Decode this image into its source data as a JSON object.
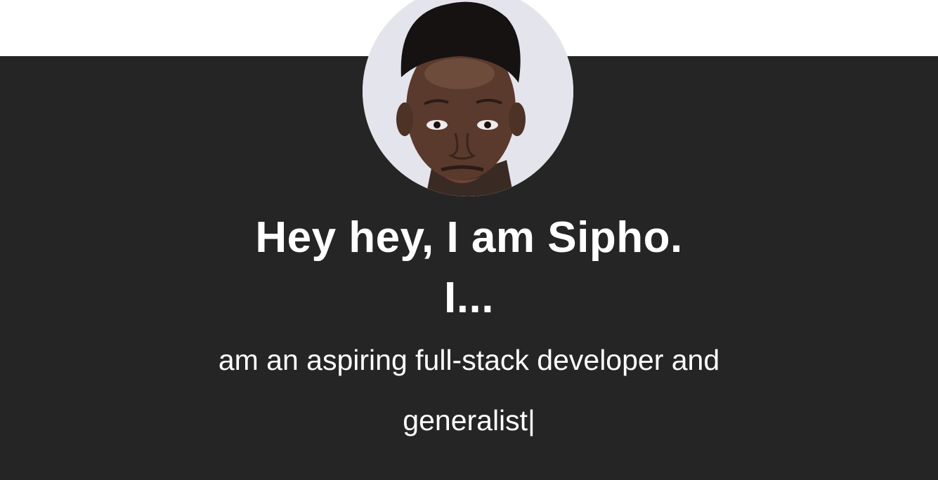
{
  "profile": {
    "avatar_alt": "Portrait photo of Sipho"
  },
  "hero": {
    "heading_line1": "Hey hey, I am Sipho.",
    "heading_line2": "I...",
    "typed_text": "am an aspiring full-stack developer and generalist",
    "cursor": "|"
  },
  "colors": {
    "hero_background": "#252525",
    "page_background": "#ffffff",
    "text": "#ffffff",
    "avatar_background": "#e6e6ee"
  },
  "icons": {
    "avatar": "profile-photo"
  }
}
